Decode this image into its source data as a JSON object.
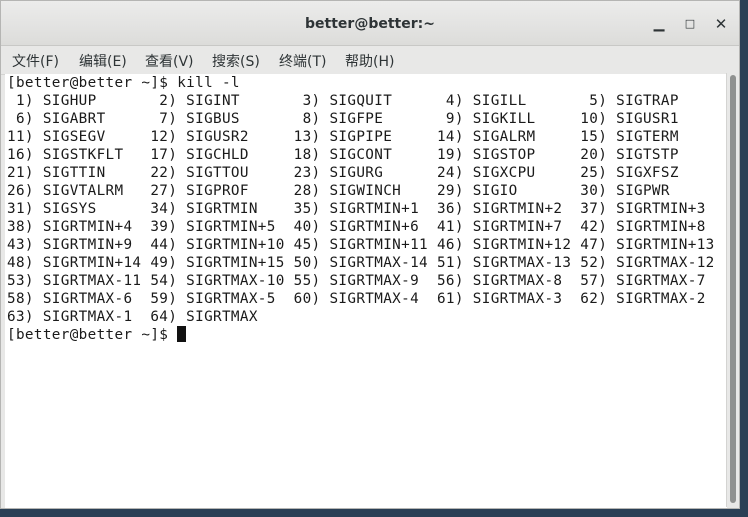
{
  "window": {
    "title": "better@better:~"
  },
  "controls": {
    "minimize": "▁",
    "maximize": "□",
    "close": "✕"
  },
  "menu": [
    {
      "label": "文件(F)"
    },
    {
      "label": "编辑(E)"
    },
    {
      "label": "查看(V)"
    },
    {
      "label": "搜索(S)"
    },
    {
      "label": "终端(T)"
    },
    {
      "label": "帮助(H)"
    }
  ],
  "terminal": {
    "command_line": "[better@better ~]$ kill -l",
    "output": [
      " 1) SIGHUP       2) SIGINT       3) SIGQUIT      4) SIGILL       5) SIGTRAP",
      " 6) SIGABRT      7) SIGBUS       8) SIGFPE       9) SIGKILL     10) SIGUSR1",
      "11) SIGSEGV     12) SIGUSR2     13) SIGPIPE     14) SIGALRM     15) SIGTERM",
      "16) SIGSTKFLT   17) SIGCHLD     18) SIGCONT     19) SIGSTOP     20) SIGTSTP",
      "21) SIGTTIN     22) SIGTTOU     23) SIGURG      24) SIGXCPU     25) SIGXFSZ",
      "26) SIGVTALRM   27) SIGPROF     28) SIGWINCH    29) SIGIO       30) SIGPWR",
      "31) SIGSYS      34) SIGRTMIN    35) SIGRTMIN+1  36) SIGRTMIN+2  37) SIGRTMIN+3",
      "38) SIGRTMIN+4  39) SIGRTMIN+5  40) SIGRTMIN+6  41) SIGRTMIN+7  42) SIGRTMIN+8",
      "43) SIGRTMIN+9  44) SIGRTMIN+10 45) SIGRTMIN+11 46) SIGRTMIN+12 47) SIGRTMIN+13",
      "48) SIGRTMIN+14 49) SIGRTMIN+15 50) SIGRTMAX-14 51) SIGRTMAX-13 52) SIGRTMAX-12",
      "53) SIGRTMAX-11 54) SIGRTMAX-10 55) SIGRTMAX-9  56) SIGRTMAX-8  57) SIGRTMAX-7",
      "58) SIGRTMAX-6  59) SIGRTMAX-5  60) SIGRTMAX-4  61) SIGRTMAX-3  62) SIGRTMAX-2",
      "63) SIGRTMAX-1  64) SIGRTMAX"
    ],
    "prompt": "[better@better ~]$ "
  },
  "colors": {
    "titlebar": "#dcdcda",
    "terminal_bg": "#ffffff",
    "desktop": "#2a3f55"
  }
}
